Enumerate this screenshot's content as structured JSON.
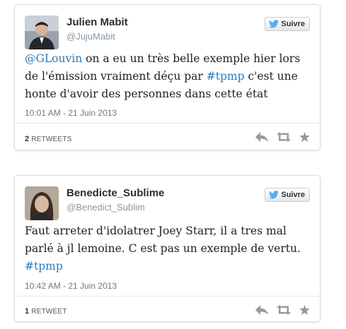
{
  "colors": {
    "link": "#2b7bb9",
    "twitter_blue": "#55acee",
    "icon_gray": "#999999"
  },
  "tweets": [
    {
      "name": "Julien Mabit",
      "handle": "@JujuMabit",
      "follow_label": "Suivre",
      "text_parts": {
        "mention": "@GLouvin",
        "mid": " on a eu un très belle exemple hier lors de l'émission vraiment déçu par ",
        "hashtag": "#tpmp",
        "end": " c'est une honte d'avoir des personnes dans cette état"
      },
      "timestamp": "10:01 AM - 21 Juin 2013",
      "retweet_count": "2",
      "retweet_label": "RETWEETS"
    },
    {
      "name": "Benedicte_Sublime",
      "handle": "@Benedict_Sublim",
      "follow_label": "Suivre",
      "text_parts": {
        "body": "Faut arreter d'idolatrer Joey Starr, il a tres mal parlé à jl lemoine. C est pas un exemple de vertu. ",
        "hashtag": "#tpmp"
      },
      "timestamp": "10:42 AM - 21 Juin 2013",
      "retweet_count": "1",
      "retweet_label": "RETWEET"
    }
  ]
}
